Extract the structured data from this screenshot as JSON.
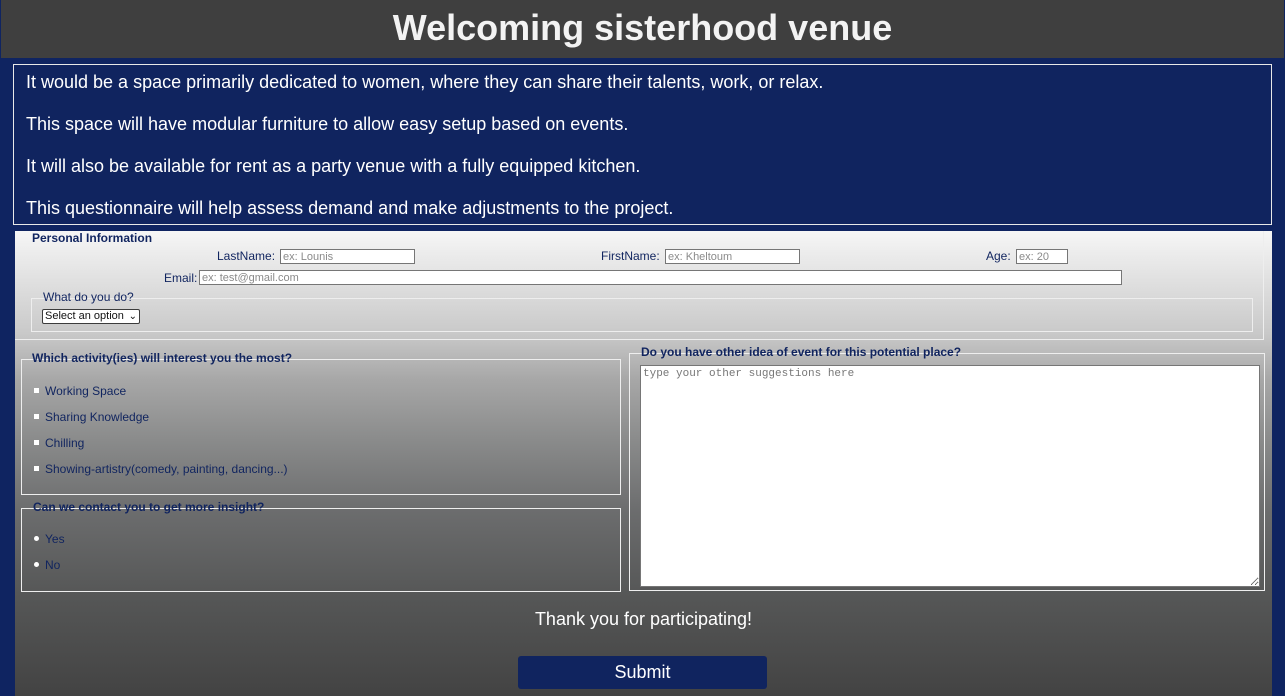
{
  "header": {
    "title": "Welcoming sisterhood venue"
  },
  "intro": {
    "paragraphs": [
      "It would be a space primarily dedicated to women, where they can share their talents, work, or relax.",
      "This space will have modular furniture to allow easy setup based on events.",
      "It will also be available for rent as a party venue with a fully equipped kitchen.",
      "This questionnaire will help assess demand and make adjustments to the project."
    ]
  },
  "personal": {
    "legend": "Personal Information",
    "lastname_label": "LastName:",
    "lastname_placeholder": "ex: Lounis",
    "firstname_label": "FirstName:",
    "firstname_placeholder": "ex: Kheltoum",
    "age_label": "Age:",
    "age_placeholder": "ex: 20",
    "email_label": "Email:",
    "email_placeholder": "ex: test@gmail.com",
    "occupation_legend": "What do you do?",
    "occupation_selected": "Select an option"
  },
  "activities": {
    "legend": "Which activity(ies) will interest you the most?",
    "options": [
      "Working Space",
      "Sharing Knowledge",
      "Chilling",
      "Showing-artistry(comedy, painting, dancing...)"
    ]
  },
  "contact": {
    "legend": "Can we contact you to get more insight?",
    "options": [
      "Yes",
      "No"
    ]
  },
  "ideas": {
    "legend": "Do you have other idea of event for this potential place?",
    "placeholder": "type your other suggestions here"
  },
  "footer": {
    "thanks": "Thank you for participating!",
    "submit_label": "Submit"
  },
  "colors": {
    "navy": "#10245f",
    "header_bg": "#3f3f3f"
  }
}
